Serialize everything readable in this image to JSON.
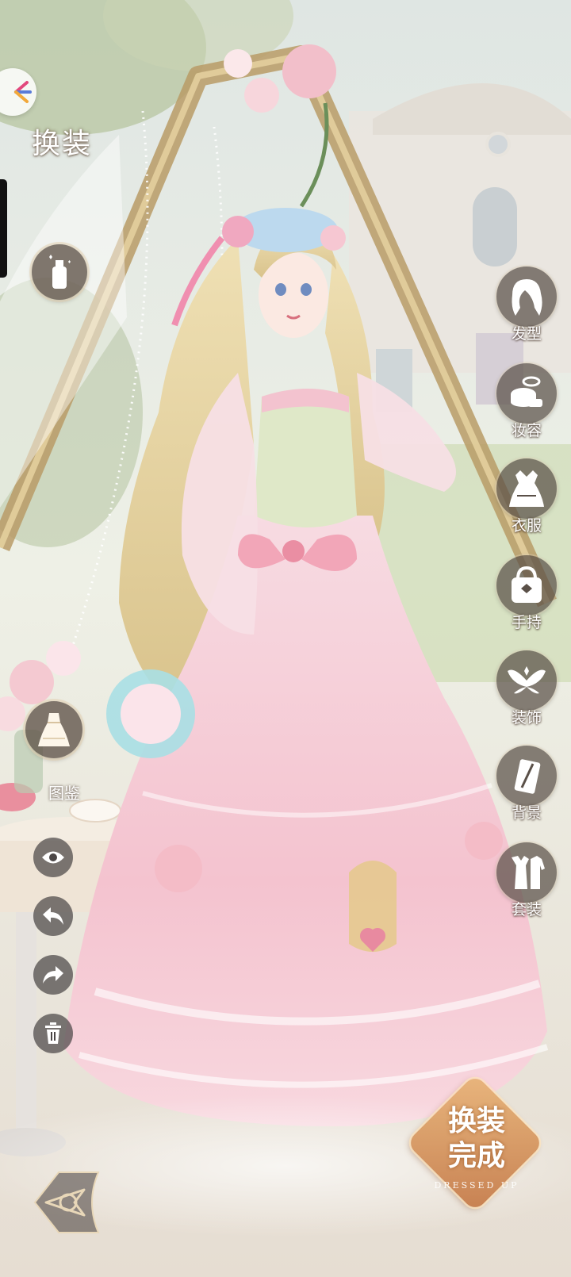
{
  "screen": {
    "title": "换装"
  },
  "left_tools": {
    "fragrance_icon": "perfume-bottle-icon",
    "catalog_label": "图鉴",
    "actions": [
      {
        "name": "hide-ui-button",
        "icon": "eye-icon"
      },
      {
        "name": "undo-button",
        "icon": "undo-arrow-icon"
      },
      {
        "name": "redo-button",
        "icon": "redo-arrow-icon"
      },
      {
        "name": "clear-button",
        "icon": "trash-icon"
      }
    ]
  },
  "right_menu": {
    "items": [
      {
        "label": "发型",
        "icon": "hairstyle-icon"
      },
      {
        "label": "妆容",
        "icon": "makeup-icon"
      },
      {
        "label": "衣服",
        "icon": "dress-icon"
      },
      {
        "label": "手持",
        "icon": "handbag-icon"
      },
      {
        "label": "装饰",
        "icon": "wings-icon"
      },
      {
        "label": "背景",
        "icon": "background-icon"
      },
      {
        "label": "套装",
        "icon": "outfit-set-icon"
      }
    ]
  },
  "done_button": {
    "line1": "换装",
    "line2": "完成",
    "subtitle": "DRESSED UP"
  },
  "colors": {
    "menu_circle": "#5a5048",
    "dress_pink": "#f6c9d3",
    "hair_blonde": "#e9d6a4",
    "done_gold": "#e0a772"
  }
}
